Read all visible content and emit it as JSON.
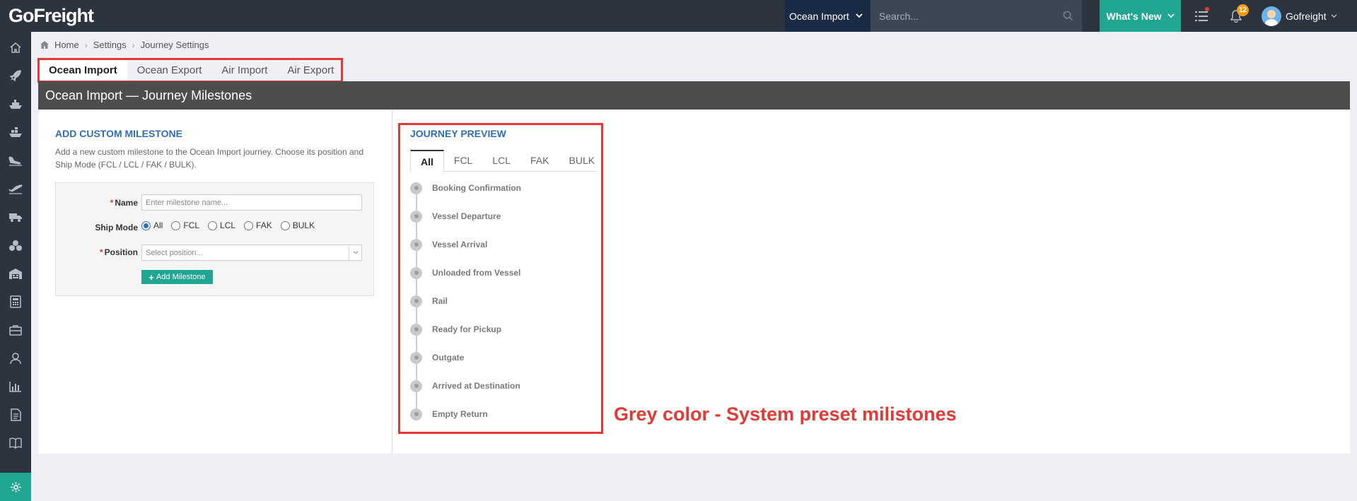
{
  "app": {
    "logo": "GoFreight"
  },
  "topbar": {
    "mode": "Ocean Import",
    "search_placeholder": "Search...",
    "whats_new": "What's New",
    "notification_count": "12",
    "user_name": "Gofreight"
  },
  "sidebar": {
    "items": [
      "home-icon",
      "rocket-icon",
      "ship-icon",
      "container-ship-icon",
      "plane-landing-icon",
      "plane-takeoff-icon",
      "truck-icon",
      "boxes-icon",
      "warehouse-icon",
      "calculator-icon",
      "briefcase-icon",
      "contacts-icon",
      "bar-chart-icon",
      "document-icon",
      "book-icon",
      "gear-icon"
    ],
    "active": "gear-icon"
  },
  "breadcrumb": [
    "Home",
    "Settings",
    "Journey Settings"
  ],
  "tabs": [
    "Ocean Import",
    "Ocean Export",
    "Air Import",
    "Air Export"
  ],
  "active_tab": "Ocean Import",
  "page_title": "Ocean Import — Journey Milestones",
  "custom": {
    "title": "ADD CUSTOM MILESTONE",
    "description": "Add a new custom milestone to the Ocean Import journey. Choose its position and Ship Mode (FCL / LCL / FAK / BULK).",
    "name_label": "Name",
    "name_placeholder": "Enter milestone name...",
    "ship_mode_label": "Ship Mode",
    "ship_modes": [
      "All",
      "FCL",
      "LCL",
      "FAK",
      "BULK"
    ],
    "ship_mode_selected": "All",
    "position_label": "Position",
    "position_placeholder": "Select position...",
    "add_button": "Add Milestone"
  },
  "preview": {
    "title": "JOURNEY PREVIEW",
    "tabs": [
      "All",
      "FCL",
      "LCL",
      "FAK",
      "BULK"
    ],
    "active_tab": "All",
    "milestones": [
      "Booking Confirmation",
      "Vessel Departure",
      "Vessel Arrival",
      "Unloaded from Vessel",
      "Rail",
      "Ready for Pickup",
      "Outgate",
      "Arrived at Destination",
      "Empty Return"
    ],
    "milestone_color": "#7a7a7a"
  },
  "annotation": "Grey color - System preset milistones",
  "colors": {
    "accent": "#21a692",
    "highlight": "#e53935",
    "link": "#2f6fb7",
    "topbar": "#2c3440"
  }
}
